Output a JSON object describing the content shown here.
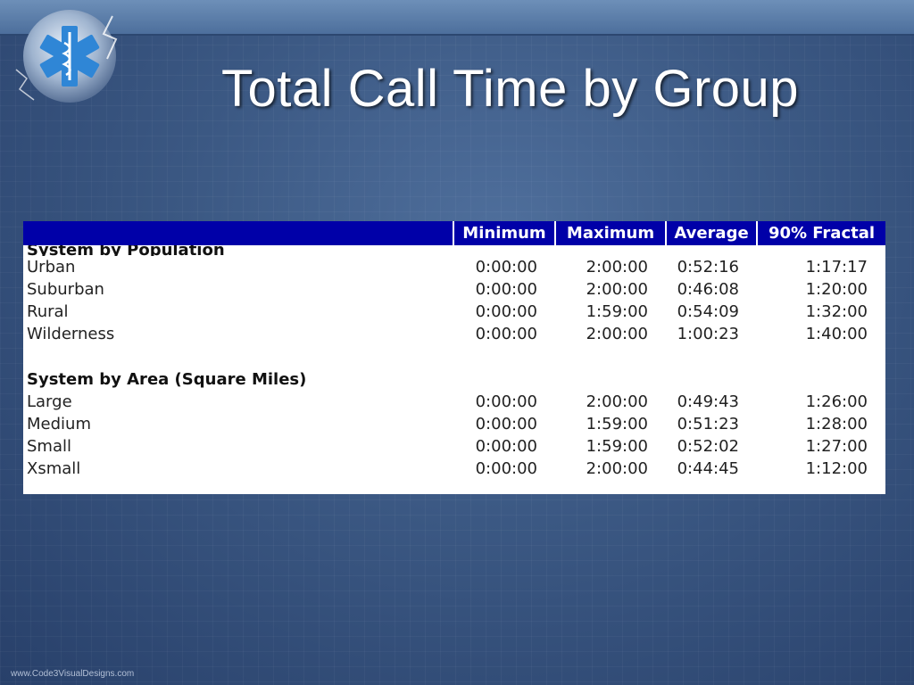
{
  "slide": {
    "title": "Total Call Time by Group",
    "footer": "www.Code3VisualDesigns.com"
  },
  "table": {
    "columns": [
      "",
      "Minimum",
      "Maximum",
      "Average",
      "90% Fractal"
    ],
    "sections": [
      {
        "heading": "System by Population",
        "rows": [
          {
            "label": "Urban",
            "min": "0:00:00",
            "max": "2:00:00",
            "avg": "0:52:16",
            "p90": "1:17:17"
          },
          {
            "label": "Suburban",
            "min": "0:00:00",
            "max": "2:00:00",
            "avg": "0:46:08",
            "p90": "1:20:00"
          },
          {
            "label": "Rural",
            "min": "0:00:00",
            "max": "1:59:00",
            "avg": "0:54:09",
            "p90": "1:32:00"
          },
          {
            "label": "Wilderness",
            "min": "0:00:00",
            "max": "2:00:00",
            "avg": "1:00:23",
            "p90": "1:40:00"
          }
        ]
      },
      {
        "heading": "System by Area (Square Miles)",
        "rows": [
          {
            "label": "Large",
            "min": "0:00:00",
            "max": "2:00:00",
            "avg": "0:49:43",
            "p90": "1:26:00"
          },
          {
            "label": "Medium",
            "min": "0:00:00",
            "max": "1:59:00",
            "avg": "0:51:23",
            "p90": "1:28:00"
          },
          {
            "label": "Small",
            "min": "0:00:00",
            "max": "1:59:00",
            "avg": "0:52:02",
            "p90": "1:27:00"
          },
          {
            "label": "Xsmall",
            "min": "0:00:00",
            "max": "2:00:00",
            "avg": "0:44:45",
            "p90": "1:12:00"
          }
        ]
      }
    ]
  },
  "colors": {
    "header_bg": "#0000a8",
    "slide_bg": "#3b5883"
  },
  "icons": [
    "star-of-life-icon"
  ]
}
